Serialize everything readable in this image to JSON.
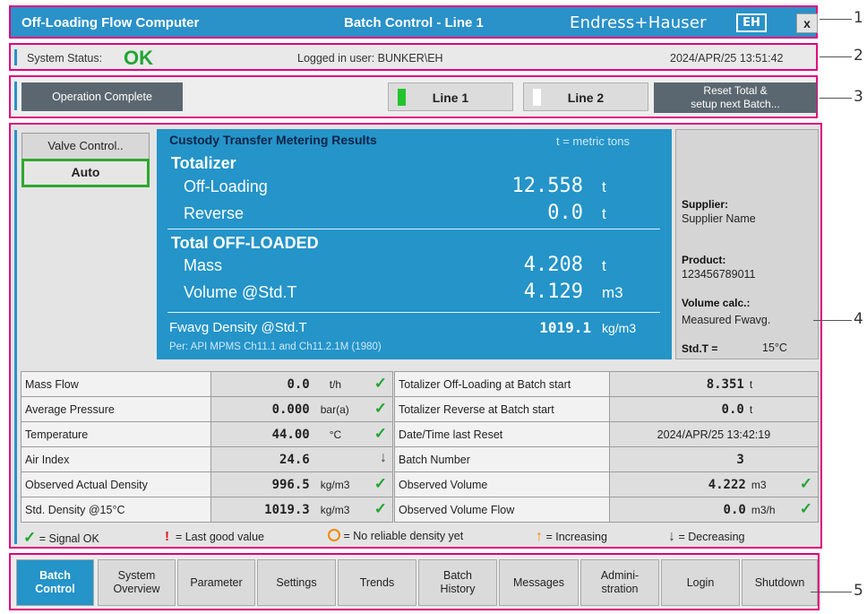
{
  "header": {
    "app_title": "Off-Loading Flow Computer",
    "screen_title": "Batch Control - Line 1",
    "brand": "Endress+Hauser",
    "brand_mark": "EH",
    "close_label": "x"
  },
  "status": {
    "label": "System Status:",
    "value": "OK",
    "user": "Logged in user: BUNKER\\EH",
    "datetime": "2024/APR/25  13:51:42"
  },
  "controls": {
    "operation": "Operation Complete",
    "line1": "Line 1",
    "line2": "Line 2",
    "reset_line1": "Reset Total &",
    "reset_line2": "setup next Batch..."
  },
  "valve": {
    "label": "Valve Control..",
    "mode": "Auto"
  },
  "ctm": {
    "heading": "Custody Transfer Metering Results",
    "unit_note": "t = metric tons",
    "totalizer": "Totalizer",
    "offloading_label": "Off-Loading",
    "offloading_value": "12.558",
    "offloading_unit": "t",
    "reverse_label": "Reverse",
    "reverse_value": "0.0",
    "reverse_unit": "t",
    "total_offloaded": "Total OFF-LOADED",
    "mass_label": "Mass",
    "mass_value": "4.208",
    "mass_unit": "t",
    "volume_label": "Volume @Std.T",
    "volume_value": "4.129",
    "volume_unit": "m3",
    "fwavg_label": "Fwavg Density @Std.T",
    "fwavg_value": "1019.1",
    "fwavg_unit": "kg/m3",
    "per": "Per: API MPMS Ch11.1 and Ch11.2.1M (1980)"
  },
  "side": {
    "supplier_label": "Supplier:",
    "supplier_value": "Supplier Name",
    "product_label": "Product:",
    "product_value": "123456789011",
    "volcalc_label": "Volume calc.:",
    "volcalc_value": "Measured Fwavg.",
    "stdt_label": "Std.T =",
    "stdt_value": "15°C"
  },
  "left_table": [
    {
      "name": "Mass Flow",
      "value": "0.0",
      "unit": "t/h",
      "status": "ok"
    },
    {
      "name": "Average Pressure",
      "value": "0.000",
      "unit": "bar(a)",
      "status": "ok"
    },
    {
      "name": "Temperature",
      "value": "44.00",
      "unit": "°C",
      "status": "ok"
    },
    {
      "name": "Air Index",
      "value": "24.6",
      "unit": "",
      "status": "decreasing"
    },
    {
      "name": "Observed Actual Density",
      "value": "996.5",
      "unit": "kg/m3",
      "status": "ok"
    },
    {
      "name": "Std. Density @15°C",
      "value": "1019.3",
      "unit": "kg/m3",
      "status": "ok"
    }
  ],
  "right_table": [
    {
      "name": "Totalizer Off-Loading at Batch start",
      "value": "8.351",
      "unit": "t",
      "status": ""
    },
    {
      "name": "Totalizer Reverse at Batch start",
      "value": "0.0",
      "unit": "t",
      "status": ""
    },
    {
      "name": "Date/Time last Reset",
      "value": "2024/APR/25 13:42:19",
      "unit": "",
      "status": ""
    },
    {
      "name": "Batch Number",
      "value": "3",
      "unit": "",
      "status": ""
    },
    {
      "name": "Observed Volume",
      "value": "4.222",
      "unit": "m3",
      "status": "ok"
    },
    {
      "name": "Observed Volume Flow",
      "value": "0.0",
      "unit": "m3/h",
      "status": "ok"
    }
  ],
  "legend": {
    "ok": "= Signal OK",
    "last": "= Last good value",
    "nodensity": "= No reliable density yet",
    "increasing": "= Increasing",
    "decreasing": "= Decreasing"
  },
  "nav": [
    {
      "label": "Batch\nControl",
      "active": true
    },
    {
      "label": "System\nOverview",
      "active": false
    },
    {
      "label": "Parameter",
      "active": false
    },
    {
      "label": "Settings",
      "active": false
    },
    {
      "label": "Trends",
      "active": false
    },
    {
      "label": "Batch\nHistory",
      "active": false
    },
    {
      "label": "Messages",
      "active": false
    },
    {
      "label": "Admini-\nstration",
      "active": false
    },
    {
      "label": "Login",
      "active": false
    },
    {
      "label": "Shutdown",
      "active": false
    }
  ],
  "callouts": [
    "1",
    "2",
    "3",
    "4",
    "5"
  ],
  "colors": {
    "accent_blue": "#2494c9",
    "ok_green": "#21a532",
    "frame_magenta": "#e0007e",
    "dark_button": "#5b6770"
  },
  "icons": {
    "close": "x-icon",
    "check": "checkmark-icon",
    "last_good": "exclamation-icon",
    "no_density": "clock-icon",
    "increasing": "arrow-up-icon",
    "decreasing": "arrow-down-icon"
  }
}
